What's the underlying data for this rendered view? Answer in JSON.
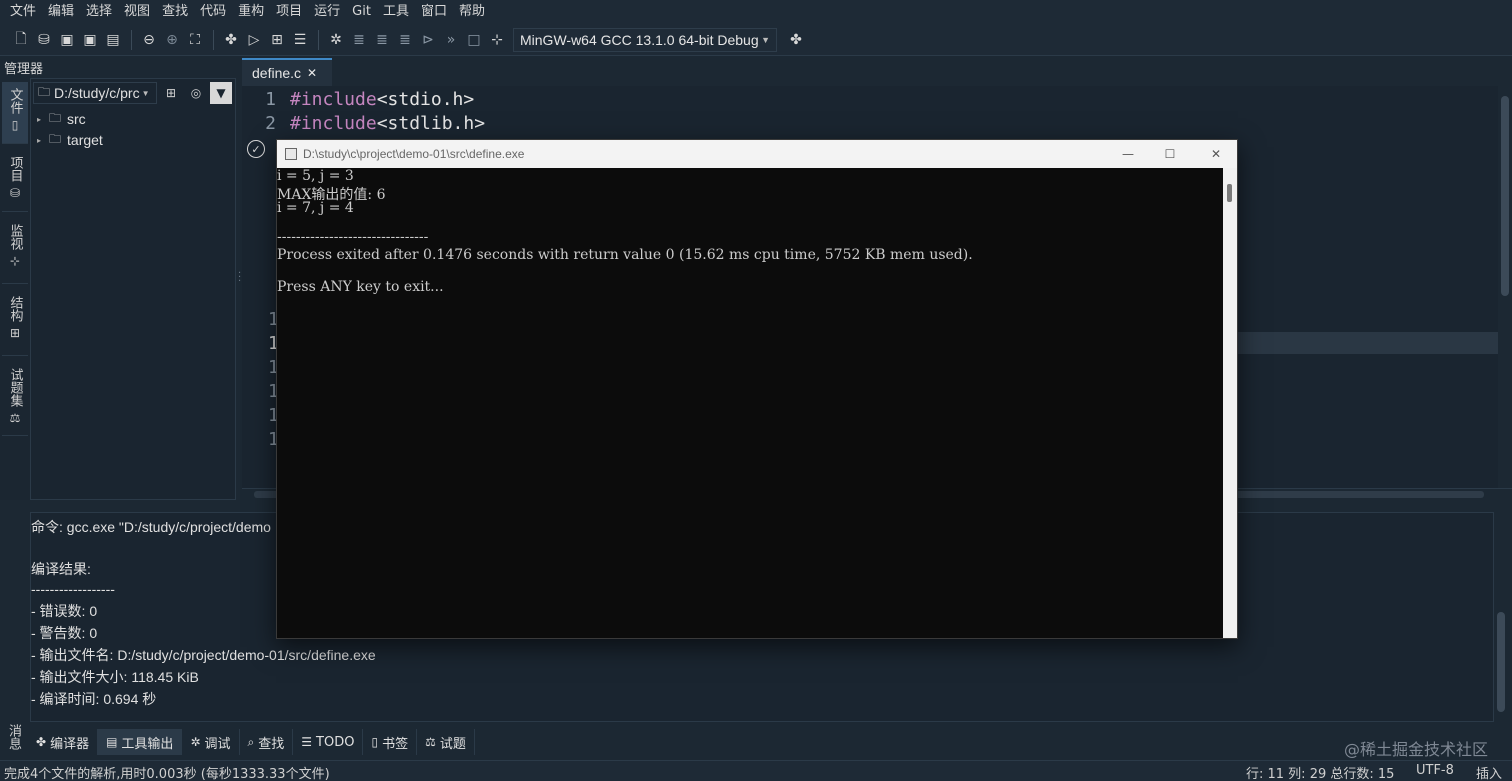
{
  "menu": [
    "文件",
    "编辑",
    "选择",
    "视图",
    "查找",
    "代码",
    "重构",
    "项目",
    "运行",
    "Git",
    "工具",
    "窗口",
    "帮助"
  ],
  "toolbar": {
    "compiler": "MinGW-w64 GCC 13.1.0 64-bit Debug",
    "icons": [
      "new-file-icon",
      "open-file-icon",
      "save-icon",
      "save-as-icon",
      "save-all-icon",
      "back-icon",
      "forward-icon",
      "locate-icon",
      "compile-icon",
      "run-icon",
      "compile-run-icon",
      "options-icon",
      "debug-icon",
      "step-icon",
      "step-into-icon",
      "step-out-icon",
      "run-to-cursor-icon",
      "continue-icon",
      "stop-icon",
      "add-watch-icon",
      "compiler-options-icon"
    ]
  },
  "left_panel": {
    "title": "管理器",
    "path": "D:/study/c/prc",
    "tree": [
      {
        "label": "src"
      },
      {
        "label": "target"
      }
    ]
  },
  "vertical_tabs": [
    {
      "label": "文件",
      "icon": "file-icon"
    },
    {
      "label": "项目",
      "icon": "project-icon"
    },
    {
      "label": "监视",
      "icon": "watch-icon"
    },
    {
      "label": "结构",
      "icon": "structure-icon"
    },
    {
      "label": "试题集",
      "icon": "problem-set-icon"
    }
  ],
  "editor": {
    "tab_label": "define.c",
    "lines": [
      {
        "num": "1",
        "kw": "#include",
        "rest": " <stdio.h>"
      },
      {
        "num": "2",
        "kw": "#include",
        "rest": " <stdlib.h>"
      }
    ],
    "partial_line_numbers": [
      "1",
      "1",
      "1",
      "1",
      "1",
      "1"
    ]
  },
  "output": {
    "lines": [
      "命令: gcc.exe  \"D:/study/c/project/demo",
      "",
      "编译结果:",
      "------------------",
      "- 错误数: 0",
      "- 警告数: 0",
      "- 输出文件名: D:/study/c/project/demo-01/src/define.exe",
      "- 输出文件大小: 118.45 KiB",
      "- 编译时间: 0.694 秒"
    ],
    "side_label": "消息"
  },
  "bottom_tabs": [
    {
      "label": "编译器",
      "icon": "compiler-icon",
      "active": true
    },
    {
      "label": "工具输出",
      "icon": "tool-output-icon",
      "active": true
    },
    {
      "label": "调试",
      "icon": "debug-icon",
      "active": false
    },
    {
      "label": "查找",
      "icon": "search-icon",
      "active": false
    },
    {
      "label": "TODO",
      "icon": "todo-icon",
      "active": false
    },
    {
      "label": "书签",
      "icon": "bookmark-icon",
      "active": false
    },
    {
      "label": "试题",
      "icon": "problem-icon",
      "active": false
    }
  ],
  "watermark": "@稀土掘金技术社区",
  "status": {
    "left": "完成4个文件的解析,用时0.003秒 (每秒1333.33个文件)",
    "position": "行: 11 列: 29 总行数: 15",
    "encoding": "UTF-8",
    "mode": "插入"
  },
  "console": {
    "title": "D:\\study\\c\\project\\demo-01\\src\\define.exe",
    "lines": [
      "i = 5, j = 3",
      "MAX输出的值: 6",
      "i = 7, j = 4",
      "",
      "--------------------------------",
      "Process exited after 0.1476 seconds with return value 0 (15.62 ms cpu time, 5752 KB mem used).",
      "",
      "Press ANY key to exit..."
    ]
  }
}
